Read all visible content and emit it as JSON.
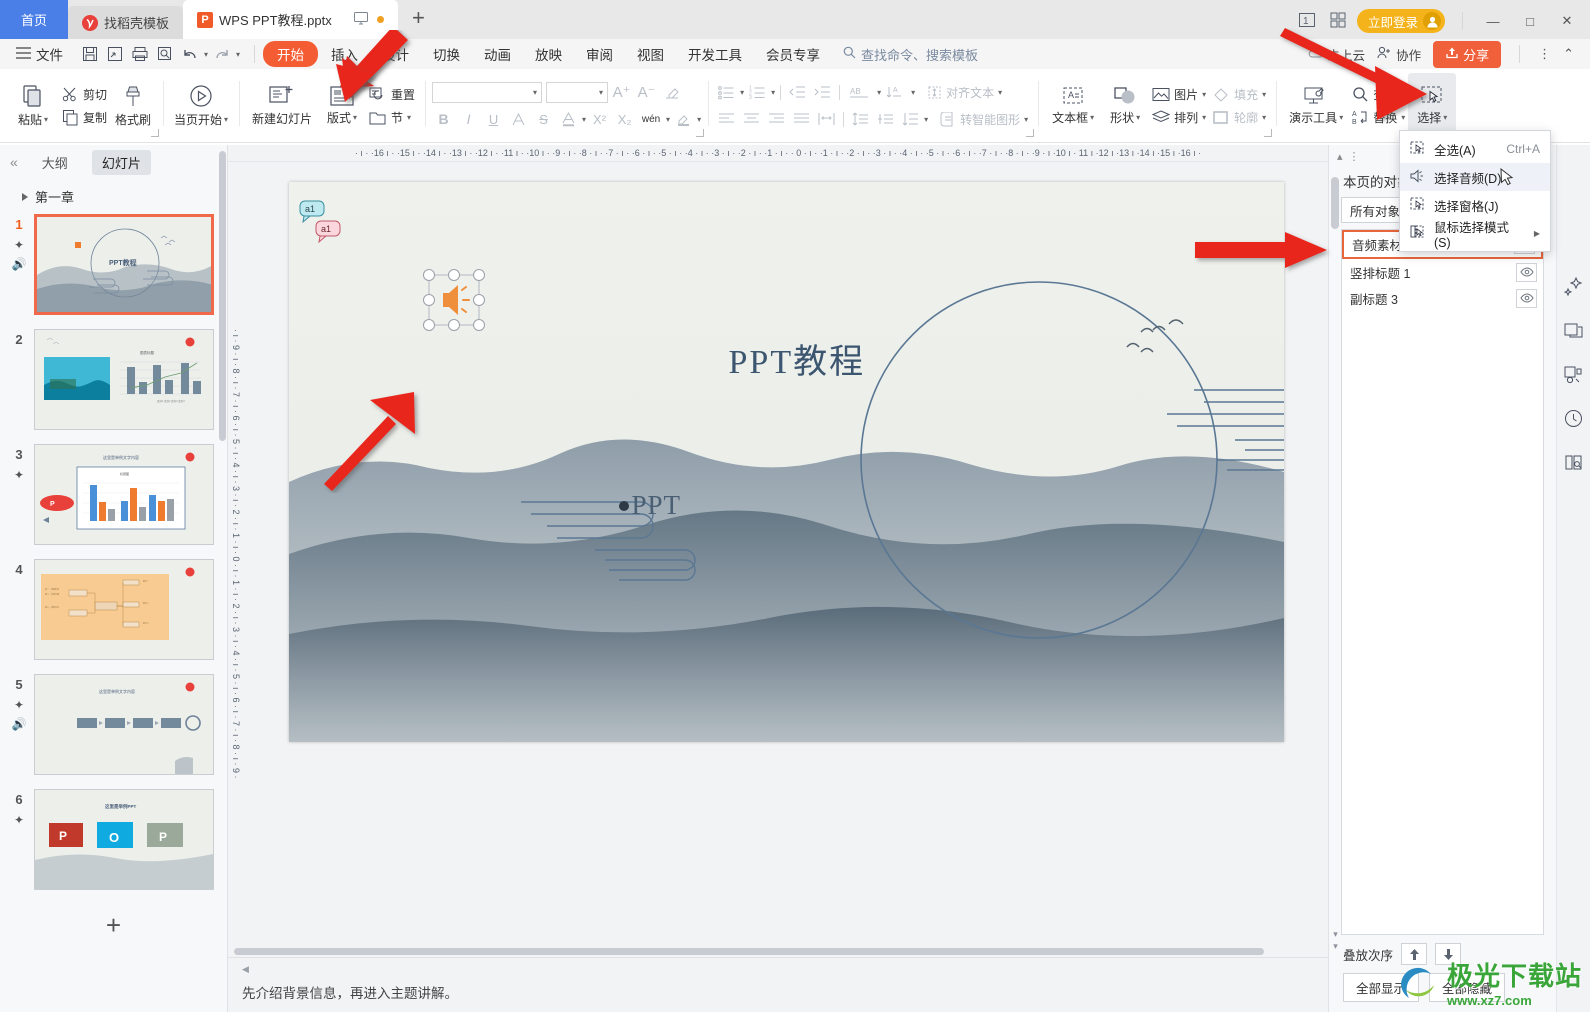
{
  "window": {
    "tabs": [
      {
        "label": "首页",
        "type": "home"
      },
      {
        "label": "找稻壳模板",
        "type": "template"
      },
      {
        "label": "WPS PPT教程.pptx",
        "type": "doc",
        "active": true
      }
    ],
    "add_tab": "+",
    "login_label": "立即登录",
    "minimize": "—",
    "maximize": "□",
    "close": "✕"
  },
  "menubar": {
    "file_label": "文件",
    "items": [
      "开始",
      "插入",
      "设计",
      "切换",
      "动画",
      "放映",
      "审阅",
      "视图",
      "开发工具",
      "会员专享"
    ],
    "selected": "开始",
    "search_placeholder": "查找命令、搜索模板",
    "cloud_label": "未上云",
    "collab_label": "协作",
    "share_label": "分享"
  },
  "ribbon": {
    "clipboard": {
      "paste": "粘贴",
      "cut": "剪切",
      "copy": "复制",
      "format_painter": "格式刷"
    },
    "play": {
      "from_current": "当页开始"
    },
    "slides": {
      "new_slide": "新建幻灯片",
      "layout": "版式",
      "reset": "重置",
      "section": "节"
    },
    "font": {
      "font_name": "",
      "font_size": "",
      "grow": "A+",
      "shrink": "A−",
      "clear_format": "清除格式",
      "bold": "B",
      "italic": "I",
      "underline": "U",
      "text_effect": "A",
      "strikethrough": "S",
      "font_color": "A",
      "superscript": "X²",
      "subscript": "X₂",
      "pinyin": "wén",
      "highlight": "highlight"
    },
    "paragraph": {
      "bullets": "bullets",
      "numbering": "numbering",
      "decrease_indent": "decrease-indent",
      "increase_indent": "increase-indent",
      "text_direction": "AB",
      "char_spacing": "char-spacing",
      "align_text": "对齐文本",
      "align_left": "align-left",
      "align_center": "align-center",
      "align_right": "align-right",
      "justify": "justify",
      "distribute": "distribute",
      "line_spacing": "line-spacing",
      "para_spacing": "para-spacing",
      "line_height": "line-height",
      "to_smartart": "转智能图形"
    },
    "drawing": {
      "textbox": "文本框",
      "shapes": "形状",
      "picture": "图片",
      "arrange": "排列",
      "fill": "填充",
      "outline": "轮廓"
    },
    "tools": {
      "present_tools": "演示工具",
      "find": "查找",
      "replace": "替换",
      "select": "选择"
    }
  },
  "select_menu": {
    "items": [
      {
        "label": "全选(A)",
        "shortcut": "Ctrl+A",
        "icon": "select-all-icon",
        "highlighted": false,
        "submenu": false
      },
      {
        "label": "选择音频(D)",
        "shortcut": "",
        "icon": "select-audio-icon",
        "highlighted": true,
        "submenu": false
      },
      {
        "label": "选择窗格(J)",
        "shortcut": "",
        "icon": "selection-pane-icon",
        "highlighted": false,
        "submenu": false
      },
      {
        "label": "鼠标选择模式(S)",
        "shortcut": "",
        "icon": "mouse-select-icon",
        "highlighted": false,
        "submenu": true
      }
    ]
  },
  "left_pane": {
    "collapse_icon": "«",
    "tabs": [
      {
        "label": "大纲",
        "active": false
      },
      {
        "label": "幻灯片",
        "active": true
      }
    ],
    "chapter": "第一章",
    "slides": [
      {
        "number": "1",
        "selected": true,
        "has_star": true,
        "has_audio": true,
        "kind": "title"
      },
      {
        "number": "2",
        "selected": false,
        "has_star": false,
        "has_audio": false,
        "kind": "photo-chart"
      },
      {
        "number": "3",
        "selected": false,
        "has_star": true,
        "has_audio": false,
        "kind": "bar-chart"
      },
      {
        "number": "4",
        "selected": false,
        "has_star": false,
        "has_audio": false,
        "kind": "mindmap"
      },
      {
        "number": "5",
        "selected": false,
        "has_star": true,
        "has_audio": true,
        "kind": "process"
      },
      {
        "number": "6",
        "selected": false,
        "has_star": true,
        "has_audio": false,
        "kind": "logos"
      }
    ],
    "add_slide": "+"
  },
  "ruler": {
    "horizontal": "· ı · ·16 ı · ·15 ı · ·14 ı · ·13 ı · ·12 ı · ·11 ı · ·10 ı · ·9 · ı · ·8 · ı · ·7 · ı · ·6 · ı · ·5 · ı · ·4 · ı · ·3 · ı · ·2 · ı · ·1 · ı · · 0 · ı · ·1 · ı · ·2 · ı · ·3 · ı · ·4 · ı · ·5 · ı · ·6 · ı · ·7 · ı · ·8 · ı · ·9 · ı ·10 ı · 11 ı ·12 ı ·13 ı ·14 ı ·15 ı ·16 ı ·",
    "vertical": "· ı · 9 · ı · 8 · ı · 7 · ı · 6 · ı · 5 · ı · 4 · ı · 3 · ı · 2 · ı · 1 · ı · 0 · ı · 1 · ı · 2 · ı · 3 · ı · 4 · ı · 5 · ı · 6 · ı · 7 · ı · 8 · ı · 9 ·"
  },
  "slide": {
    "title": "PPT教程",
    "subtitle": "PPT",
    "animation_tags": [
      "a1",
      "a1"
    ],
    "audio_object": "audio-speaker-icon"
  },
  "notes": {
    "text": "先介绍背景信息，再进入主题讲解。"
  },
  "selection_pane": {
    "title": "本页的对象",
    "filter": "所有对象",
    "objects": [
      {
        "label": "音频素材 - 1967",
        "selected": true,
        "visible_icon": "eye-icon"
      },
      {
        "label": "竖排标题 1",
        "selected": false,
        "visible_icon": "eye-icon"
      },
      {
        "label": "副标题 3",
        "selected": false,
        "visible_icon": "eye-icon"
      }
    ],
    "order_label": "叠放次序",
    "move_up": "↑",
    "move_down": "↓",
    "show_all": "全部显示",
    "hide_all": "全部隐藏"
  },
  "right_rail": {
    "icons": [
      "sparkle-icon",
      "slide-copy-icon",
      "design-ideas-icon",
      "lightbulb-icon",
      "reader-icon"
    ]
  },
  "watermark": {
    "name": "极光下载站",
    "url": "www.xz7.com"
  },
  "colors": {
    "accent_orange": "#f45d33",
    "tab_blue": "#4b7fe8",
    "login_yellow": "#f5b31b",
    "selection_red": "#e8663c",
    "arrow_red": "#e8261b"
  }
}
